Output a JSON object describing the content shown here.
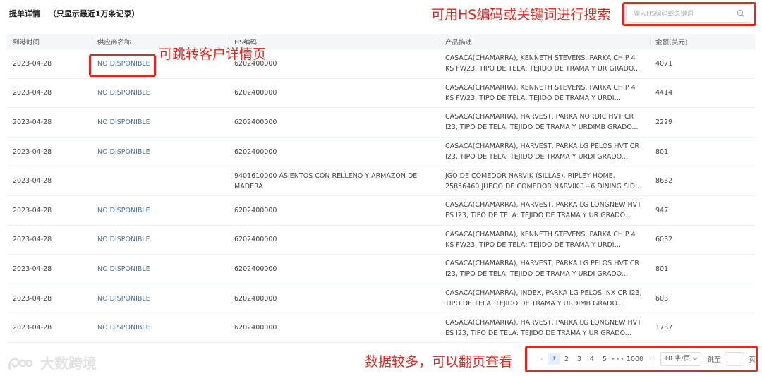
{
  "header": {
    "title": "提单详情",
    "subtitle": "（只显示最近1万条记录）"
  },
  "search": {
    "placeholder": "输入HS编码或关键词",
    "icon": "search-icon"
  },
  "table": {
    "columns": [
      "到港时间",
      "供应商名称",
      "HS编码",
      "产品描述",
      "金额(美元)"
    ],
    "rows": [
      {
        "date": "2023-04-28",
        "supplier": "NO DISPONIBLE",
        "hs": "6202400000",
        "desc": "CASACA(CHAMARRA), KENNETH STEVENS, PARKA CHIP 4 KS FW23, TIPO DE TELA: TEJIDO DE TRAMA Y UR GRADO...",
        "amount": "4071"
      },
      {
        "date": "2023-04-28",
        "supplier": "NO DISPONIBLE",
        "hs": "6202400000",
        "desc": "CASACA(CHAMARRA), KENNETH STEVENS, PARKA CHIP 4 KS FW23, TIPO DE TELA: TEJIDO DE TRAMA Y URDI GRADO...",
        "amount": "4414"
      },
      {
        "date": "2023-04-28",
        "supplier": "NO DISPONIBLE",
        "hs": "6202400000",
        "desc": "CASACA(CHAMARRA), HARVEST, PARKA NORDIC HVT CR I23, TIPO DE TELA: TEJIDO DE TRAMA Y URDIMB GRADO...",
        "amount": "2229"
      },
      {
        "date": "2023-04-28",
        "supplier": "NO DISPONIBLE",
        "hs": "6202400000",
        "desc": "CASACA(CHAMARRA), HARVEST, PARKA LG PELOS HVT CR I23, TIPO DE TELA: TEJIDO DE TRAMA Y URDI GRADO...",
        "amount": "801"
      },
      {
        "date": "2023-04-28",
        "supplier": "",
        "hs": "9401610000 ASIENTOS CON RELLENO Y ARMAZON DE MADERA",
        "desc": "JGO DE COMEDOR NARVIK (SILLAS), RIPLEY HOME, 25856460 JUEGO DE COMEDOR NARVIK 1+6 DINING SIDE CHAIR",
        "amount": "8632"
      },
      {
        "date": "2023-04-28",
        "supplier": "NO DISPONIBLE",
        "hs": "6202400000",
        "desc": "CASACA(CHAMARRA), HARVEST, PARKA LG LONGNEW HVT ES I23, TIPO DE TELA: TEJIDO DE TRAMA Y UR GRADO...",
        "amount": "947"
      },
      {
        "date": "2023-04-28",
        "supplier": "NO DISPONIBLE",
        "hs": "6202400000",
        "desc": "CASACA(CHAMARRA), KENNETH STEVENS, PARKA CHIP 4 KS FW23, TIPO DE TELA: TEJIDO DE TRAMA Y URDI GRADO...",
        "amount": "6032"
      },
      {
        "date": "2023-04-28",
        "supplier": "NO DISPONIBLE",
        "hs": "6202400000",
        "desc": "CASACA(CHAMARRA), HARVEST, PARKA LG PELOS HVT CR I23, TIPO DE TELA: TEJIDO DE TRAMA Y URDI GRADO...",
        "amount": "801"
      },
      {
        "date": "2023-04-28",
        "supplier": "NO DISPONIBLE",
        "hs": "6202400000",
        "desc": "CASACA(CHAMARRA), INDEX, PARKA LG PELOS INX CR I23, TIPO DE TELA: TEJIDO DE TRAMA Y URDIMB GRADO...",
        "amount": "603"
      },
      {
        "date": "2023-04-28",
        "supplier": "NO DISPONIBLE",
        "hs": "6202400000",
        "desc": "CASACA(CHAMARRA), HARVEST, PARKA LG LONGNEW HVT ES I23, TIPO DE TELA: TEJIDO DE TRAMA Y UR GRADO...",
        "amount": "1737"
      }
    ]
  },
  "pagination": {
    "pages": [
      "1",
      "2",
      "3",
      "4",
      "5"
    ],
    "ellipsis": "•••",
    "last": "1000",
    "active": "1",
    "page_size": "10 条/页",
    "jump_label": "跳至",
    "page_unit": "页"
  },
  "annotations": {
    "search_note": "可用HS编码或关键词进行搜索",
    "supplier_note": "可跳转客户详情页",
    "pager_note": "数据较多，可以翻页查看",
    "color": "#e8251d"
  },
  "watermark": {
    "text": "大数跨境"
  }
}
